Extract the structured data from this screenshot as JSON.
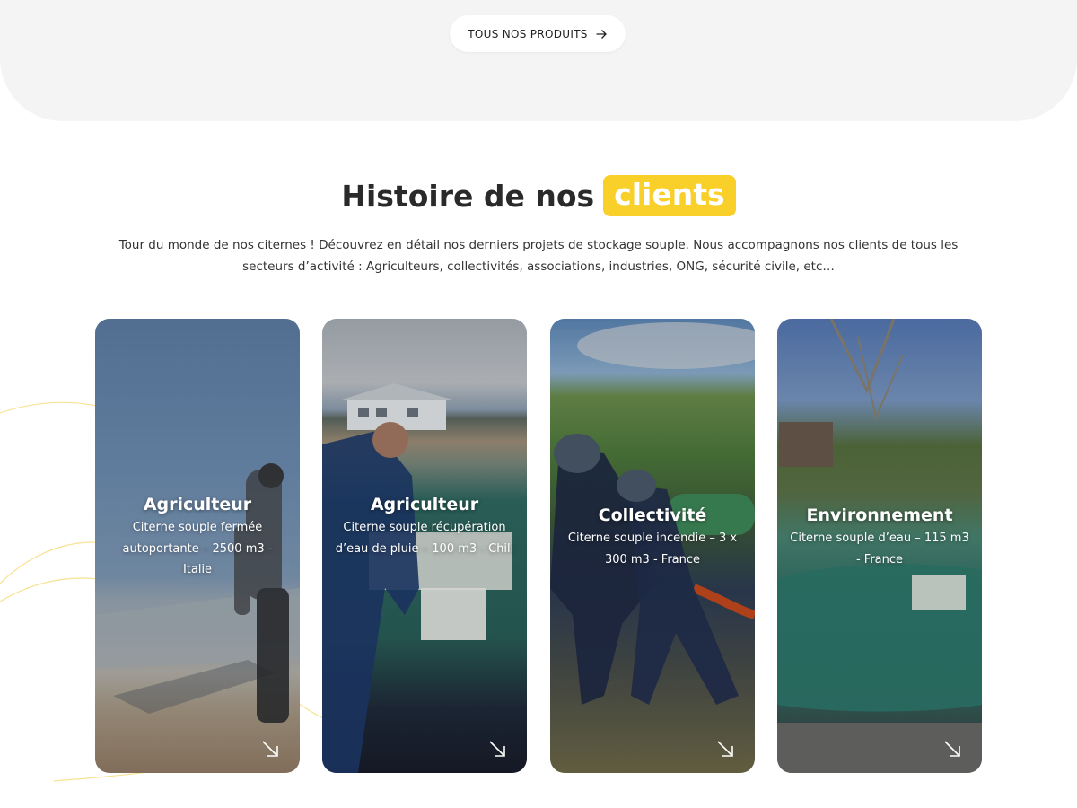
{
  "cta": {
    "label": "TOUS NOS PRODUITS",
    "icon": "arrow-right-icon"
  },
  "section": {
    "title_prefix": "Histoire de nos",
    "title_highlight": "clients",
    "highlight_color": "#f9cf2a",
    "intro": "Tour du monde de nos citernes ! Découvrez en détail nos derniers projets de stockage souple. Nous accompagnons nos clients de tous les secteurs d’activité : Agriculteurs, collectivités, associations, industries, ONG, sécurité civile, etc…"
  },
  "cards": [
    {
      "title": "Agriculteur",
      "subtitle": "Citerne souple fermée autoportante – 2500 m3 - Italie",
      "icon": "arrow-down-right-icon"
    },
    {
      "title": "Agriculteur",
      "subtitle": "Citerne souple récupération d’eau de pluie – 100 m3 - Chili",
      "icon": "arrow-down-right-icon"
    },
    {
      "title": "Collectivité",
      "subtitle": "Citerne souple incendie – 3 x 300 m3 - France",
      "icon": "arrow-down-right-icon"
    },
    {
      "title": "Environnement",
      "subtitle": "Citerne souple d’eau – 115 m3 - France",
      "icon": "arrow-down-right-icon"
    }
  ]
}
